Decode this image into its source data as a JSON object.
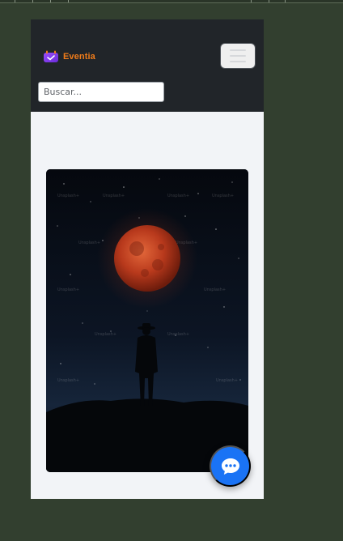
{
  "app": {
    "brand_name": "Eventia",
    "brand_color": "#f07c1a",
    "brand_icon": "calendar-ticket-icon"
  },
  "navbar": {
    "background": "#212529",
    "menu_icon": "hamburger-menu-icon"
  },
  "search": {
    "placeholder": "Buscar..."
  },
  "featured_image": {
    "subject": "person-under-red-moon",
    "watermark": "Unsplash+"
  },
  "chat_button": {
    "icon": "chat-bubble-icon",
    "color": "#1a73f5"
  }
}
